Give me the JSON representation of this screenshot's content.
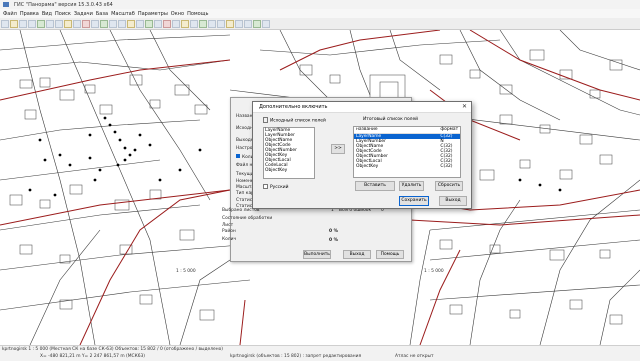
{
  "window": {
    "title": "ГИС \"Панорама\" версия 15.3.0.43 x64"
  },
  "menu": [
    "Файл",
    "Правка",
    "Вид",
    "Поиск",
    "Задачи",
    "База",
    "Масштаб",
    "Параметры",
    "Окно",
    "Помощь"
  ],
  "colors": {
    "road": "#9b1c1c",
    "selection": "#0a64d0",
    "map_line": "#3a3a3a"
  },
  "background_dialog": {
    "labels": [
      "Название",
      "Исходн",
      "Выходн",
      "Настрой",
      "Колич",
      "Файл нас",
      "Текущий",
      "Номенкл",
      "Масштаб",
      "Тип карты",
      "Статист",
      "Статист"
    ],
    "checkbox_label": "Колич",
    "selected_sheets_label": "Выбрано листов",
    "selected_sheets_value": "1",
    "total_errors_label": "Всего ошибок",
    "total_errors_value": "0",
    "state_label": "Состояние обработки",
    "sheet_label": "Лист",
    "region_label": "Район",
    "region_percent": "0 %",
    "sheet_percent": "0 %",
    "run_button": "Выполнить",
    "cancel_button": "Выход",
    "help_button": "Помощь"
  },
  "dialog": {
    "title": "Дополнительно включить",
    "source_list_label": "Исходный список полей",
    "result_list_label": "Итоговый список полей",
    "move_button": ">>",
    "source_fields": [
      "LayerName",
      "LayerNumber",
      "ObjectName",
      "ObjectCode",
      "ObjectNumber",
      "ObjectKey",
      "ObjectLocal",
      "CodeLocal",
      "ObjectKey"
    ],
    "result_columns": {
      "name": "название",
      "format": "формат"
    },
    "result_fields": [
      {
        "name": "LayerName",
        "format": "C(32)",
        "selected": true
      },
      {
        "name": "LayerNumber",
        "format": "N"
      },
      {
        "name": "ObjectName",
        "format": "C(32)"
      },
      {
        "name": "ObjectCode",
        "format": "C(32)"
      },
      {
        "name": "ObjectNumber",
        "format": "C(32)"
      },
      {
        "name": "ObjectLocal",
        "format": "C(32)"
      },
      {
        "name": "ObjectKey",
        "format": "C(32)"
      }
    ],
    "russian_checkbox": "Русский",
    "insert_button": "Вставить",
    "delete_button": "Удалить",
    "reset_button": "Сбросить",
    "save_button": "Сохранить",
    "exit_button": "Выход"
  },
  "mini_status": {
    "scale_left": "1 : 5 000",
    "scale_right": "1 : 5 000"
  },
  "status": {
    "line1": "kprtnogirsk   1 : 5 000 (Местная СК на базе СК-63) Объектов: 15 802 / 0 (отображено / выделено)",
    "line2": "X= -480 821,21 m     Y= 2 247 861,57 m   (МСК63)",
    "line3": "kprtnogirsk   (объектов : 15 802) : запрет редактирования",
    "line4": "Атлас не открыт"
  }
}
